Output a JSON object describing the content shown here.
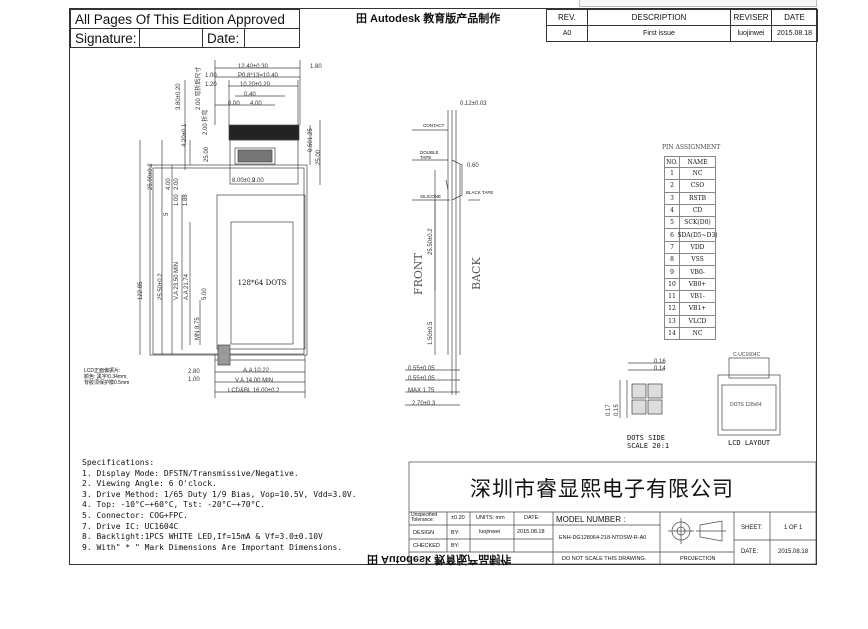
{
  "approval": {
    "text": "All Pages Of This Edition Approved",
    "signature": "Signature:",
    "date": "Date:"
  },
  "watermark": {
    "top": "田 Autodesk 教育版产品制作",
    "bottom": "田 Autodesk 教育版产品制作"
  },
  "revision": {
    "headers": [
      "REV.",
      "DESCRIPTION",
      "REVISER",
      "DATE"
    ],
    "row": [
      "A0",
      "First issue",
      "luojinwei",
      "2015.08.18"
    ]
  },
  "front_view": {
    "dims_top": [
      "12.40±0.30",
      "1.80",
      "1.00",
      "P0.8*13=10.40",
      "1.20",
      "10.20±0.20",
      "0.40",
      "2.00",
      "6.00",
      "4.00",
      "2.00 弯折后尺寸",
      "2.00 折弯"
    ],
    "dims_left": [
      "3.80±0.20",
      "4.20±0.1",
      "25.00",
      "25.00±0.2",
      "4.00",
      "2.00",
      "5",
      "1.00",
      "1.88",
      "25.50±0.2",
      "V.A 23.50 MIN",
      "A.A 21.74",
      "MN 8.75",
      "5.00",
      "122.85"
    ],
    "dims_right": [
      "0.50",
      "1.25",
      "25.00",
      "8.00±0.2",
      "9.00"
    ],
    "dims_bottom": [
      "2.80",
      "1.00",
      "A.A 10.22",
      "V.A 14.00 MIN",
      "LCD&BL 16.00±0.2"
    ],
    "display_label": "128*64 DOTS",
    "lcd_note": [
      "LCD正面偏振片:",
      "颜色: 黑字/0.34mm,",
      "背胶须保护膜0.5mm"
    ]
  },
  "side_view": {
    "labels": [
      "CONTACT",
      "DOUBLE TAPE",
      "SILICONE",
      "BLACK TAPE"
    ],
    "dims": [
      "0.12±0.03",
      "0.60",
      "25.50±0.2",
      "1.50±0.5",
      "0.55±0.05",
      "0.55±0.05",
      "MAX 1.75",
      "2.70±0.3"
    ],
    "front": "FRONT",
    "back": "BACK"
  },
  "pin_assignment": {
    "title": "PIN ASSIGNMENT",
    "headers": [
      "NO.",
      "NAME"
    ],
    "rows": [
      [
        "1",
        "NC"
      ],
      [
        "2",
        "CSO"
      ],
      [
        "3",
        "RSTB"
      ],
      [
        "4",
        "CD"
      ],
      [
        "5",
        "SCK(D0)"
      ],
      [
        "6",
        "SDA(D5~D3)"
      ],
      [
        "7",
        "VDD"
      ],
      [
        "8",
        "VSS"
      ],
      [
        "9",
        "VB0-"
      ],
      [
        "10",
        "VB0+"
      ],
      [
        "11",
        "VB1-"
      ],
      [
        "12",
        "VB1+"
      ],
      [
        "13",
        "VLCD"
      ],
      [
        "14",
        "NC"
      ]
    ]
  },
  "dots": {
    "dims": [
      "0.16",
      "0.14",
      "0.17",
      "0.15"
    ],
    "title": "DOTS SIDE",
    "scale": "SCALE 20:1"
  },
  "lcd_layout": {
    "title": "LCD LAYOUT",
    "ic": "C-UC1604C",
    "inner": "DOTS 128x64"
  },
  "specifications": {
    "title": "Specifications:",
    "items": [
      "1. Display Mode: DFSTN/Transmissive/Negative.",
      "2. Viewing Angle:  6 O'clock.",
      "3. Drive Method: 1/65 Duty 1/9 Bias, Vop=10.5V, Vdd=3.0V.",
      "4. Top: -10°C~+60°C, Tst: -20°C~+70°C.",
      "5. Connector:  COG+FPC.",
      "7. Drive IC: UC1604C",
      "8. Backlight:1PCS WHITE LED,If=15mA & Vf=3.0±0.10V",
      "9. With\" * \" Mark Dimensions Are Important Dimensions."
    ]
  },
  "title_block": {
    "company": "深圳市睿显熙电子有限公司",
    "unspecified": "Unspecified Tolerance:",
    "tolerance": "±0.20",
    "units": "UNITS: mm",
    "date_label": "DATE:",
    "design_label": "DESIGN",
    "by": "BY:",
    "designer": "luojinwei",
    "design_date": "2015.08.18",
    "checked_label": "CHECKED",
    "check_by": "BY:",
    "model_label": "MODEL NUMBER :",
    "model": "ENH-DG128064-218-NTDSW-R-A0",
    "no_scale": "DO NOT SCALE THIS DRAWING.",
    "projection": "PROJECTION",
    "sheet_label": "SHEET:",
    "sheet_value": "1 OF 1",
    "date2_label": "DATE:",
    "date2": "2015.08.18"
  }
}
